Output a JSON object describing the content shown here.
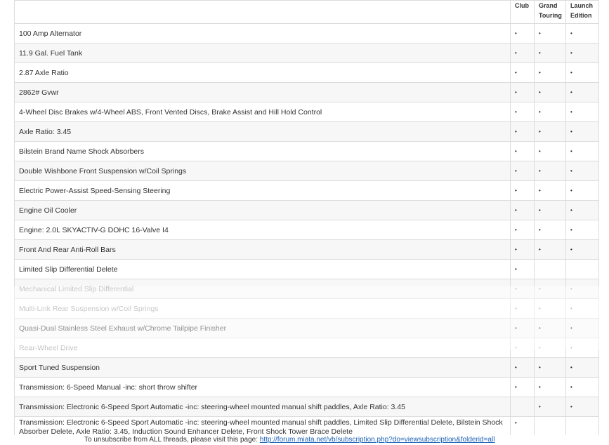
{
  "table": {
    "headers": {
      "club": "Club",
      "grand_touring": "Grand Touring",
      "launch_edition": "Launch Edition"
    },
    "rows": [
      {
        "feature": "100 Amp Alternator",
        "club": "•",
        "gt": "•",
        "le": "•"
      },
      {
        "feature": "11.9 Gal. Fuel Tank",
        "club": "•",
        "gt": "•",
        "le": "•"
      },
      {
        "feature": "2.87 Axle Ratio",
        "club": "•",
        "gt": "•",
        "le": "•"
      },
      {
        "feature": "2862# Gvwr",
        "club": "•",
        "gt": "•",
        "le": "•"
      },
      {
        "feature": "4-Wheel Disc Brakes w/4-Wheel ABS, Front Vented Discs, Brake Assist and Hill Hold Control",
        "club": "•",
        "gt": "•",
        "le": "•"
      },
      {
        "feature": "Axle Ratio: 3.45",
        "club": "•",
        "gt": "•",
        "le": "•"
      },
      {
        "feature": "Bilstein Brand Name Shock Absorbers",
        "club": "•",
        "gt": "•",
        "le": "•"
      },
      {
        "feature": "Double Wishbone Front Suspension w/Coil Springs",
        "club": "•",
        "gt": "•",
        "le": "•"
      },
      {
        "feature": "Electric Power-Assist Speed-Sensing Steering",
        "club": "•",
        "gt": "•",
        "le": "•"
      },
      {
        "feature": "Engine Oil Cooler",
        "club": "•",
        "gt": "•",
        "le": "•"
      },
      {
        "feature": "Engine: 2.0L SKYACTIV-G DOHC 16-Valve I4",
        "club": "•",
        "gt": "•",
        "le": "•"
      },
      {
        "feature": "Front And Rear Anti-Roll Bars",
        "club": "•",
        "gt": "•",
        "le": "•"
      },
      {
        "feature": "Limited Slip Differential Delete",
        "club": "•",
        "gt": "",
        "le": ""
      },
      {
        "feature": "Mechanical Limited Slip Differential",
        "club": "•",
        "gt": "•",
        "le": "•"
      },
      {
        "feature": "Multi-Link Rear Suspension w/Coil Springs",
        "club": "•",
        "gt": "•",
        "le": "•"
      },
      {
        "feature": "Quasi-Dual Stainless Steel Exhaust w/Chrome Tailpipe Finisher",
        "club": "•",
        "gt": "•",
        "le": "•"
      },
      {
        "feature": "Rear-Wheel Drive",
        "club": "•",
        "gt": "•",
        "le": "•"
      },
      {
        "feature": "Sport Tuned Suspension",
        "club": "•",
        "gt": "•",
        "le": "•"
      },
      {
        "feature": "Transmission: 6-Speed Manual -inc: short throw shifter",
        "club": "•",
        "gt": "•",
        "le": "•"
      },
      {
        "feature": "Transmission: Electronic 6-Speed Sport Automatic -inc: steering-wheel mounted manual shift paddles, Axle Ratio: 3.45",
        "club": "",
        "gt": "•",
        "le": "•"
      },
      {
        "feature": "Transmission: Electronic 6-Speed Sport Automatic -inc: steering-wheel mounted manual shift paddles, Limited Slip Differential Delete, Bilstein Shock Absorber Delete, Axle Ratio: 3.45, Induction Sound Enhancer Delete, Front Shock Tower Brace Delete",
        "club": "•",
        "gt": "",
        "le": ""
      }
    ]
  },
  "footer": {
    "text": "To unsubscribe from ALL threads, please visit this page:",
    "link": "http://forum.miata.net/vb/subscription.php?do=viewsubscription&folderid=all"
  }
}
